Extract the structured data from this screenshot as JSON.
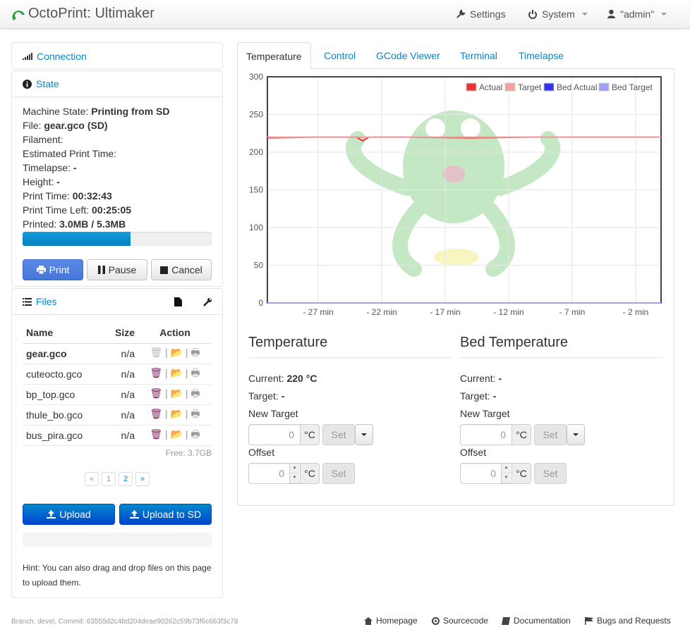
{
  "navbar": {
    "brand": "OctoPrint: Ultimaker",
    "settings": "Settings",
    "system": "System",
    "user": "\"admin\""
  },
  "connection": {
    "title": "Connection"
  },
  "state": {
    "title": "State",
    "machine_state_label": "Machine State:",
    "machine_state": "Printing from SD",
    "file_label": "File:",
    "file": "gear.gco (SD)",
    "filament_label": "Filament:",
    "est_time_label": "Estimated Print Time:",
    "timelapse_label": "Timelapse:",
    "timelapse": "-",
    "height_label": "Height:",
    "height": "-",
    "print_time_label": "Print Time:",
    "print_time": "00:32:43",
    "time_left_label": "Print Time Left:",
    "time_left": "00:25:05",
    "printed_label": "Printed:",
    "printed": "3.0MB / 5.3MB",
    "progress_fraction": 0.57,
    "print_btn": "Print",
    "pause_btn": "Pause",
    "cancel_btn": "Cancel"
  },
  "files": {
    "title": "Files",
    "col_name": "Name",
    "col_size": "Size",
    "col_action": "Action",
    "rows": [
      {
        "name": "gear.gco",
        "size": "n/a",
        "bold": true
      },
      {
        "name": "cuteocto.gco",
        "size": "n/a"
      },
      {
        "name": "bp_top.gco",
        "size": "n/a"
      },
      {
        "name": "thule_bo.gco",
        "size": "n/a"
      },
      {
        "name": "bus_pira.gco",
        "size": "n/a"
      }
    ],
    "free": "Free: 3.7GB",
    "pager": [
      "«",
      "1",
      "2",
      "»"
    ],
    "upload_btn": "Upload",
    "upload_sd_btn": "Upload to SD",
    "hint": "Hint: You can also drag and drop files on this page to upload them."
  },
  "tabs": [
    "Temperature",
    "Control",
    "GCode Viewer",
    "Terminal",
    "Timelapse"
  ],
  "chart_data": {
    "type": "line",
    "ylim": [
      0,
      300
    ],
    "yticks": [
      0,
      50,
      100,
      150,
      200,
      250,
      300
    ],
    "xticks": [
      "- 27 min",
      "- 22 min",
      "- 17 min",
      "- 12 min",
      "- 7 min",
      "- 2 min"
    ],
    "legend": [
      "Actual",
      "Target",
      "Bed Actual",
      "Bed Target"
    ],
    "legend_placement": "top-right",
    "series": [
      {
        "name": "Actual",
        "color": "#ee3333",
        "x": [
          -31,
          -27,
          -24,
          -23.5,
          -23,
          -20,
          -15,
          -10,
          -5,
          0
        ],
        "values": [
          219,
          220,
          220,
          215,
          220,
          220,
          219,
          220,
          220,
          220
        ]
      },
      {
        "name": "Target",
        "color": "#f4a0a0",
        "x": [
          -31,
          0
        ],
        "values": [
          220,
          220
        ]
      },
      {
        "name": "Bed Actual",
        "color": "#3333ee",
        "x": [
          -31,
          0
        ],
        "values": [
          0,
          0
        ]
      },
      {
        "name": "Bed Target",
        "color": "#a0a0f4",
        "x": [
          -31,
          0
        ],
        "values": [
          0,
          0
        ]
      }
    ]
  },
  "temperature": {
    "title": "Temperature",
    "current_label": "Current:",
    "current": "220 °C",
    "target_label": "Target:",
    "target": "-",
    "new_target_label": "New Target",
    "offset_label": "Offset",
    "input_value": "0",
    "unit": "°C",
    "set_btn": "Set"
  },
  "bed": {
    "title": "Bed Temperature",
    "current_label": "Current:",
    "current": "-",
    "target_label": "Target:",
    "target": "-",
    "new_target_label": "New Target",
    "offset_label": "Offset",
    "input_value": "0",
    "unit": "°C",
    "set_btn": "Set"
  },
  "footer": {
    "branch": "Branch: devel, Commit: 63555d2c4bd204deae90262c59b73f6c663f3c79",
    "homepage": "Homepage",
    "sourcecode": "Sourcecode",
    "documentation": "Documentation",
    "bugs": "Bugs and Requests"
  }
}
